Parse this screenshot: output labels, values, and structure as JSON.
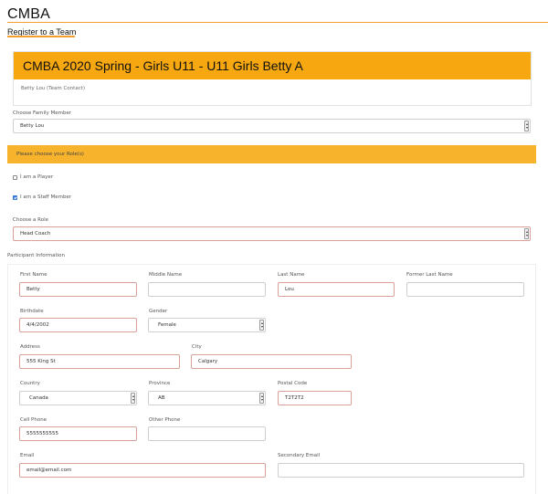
{
  "site": {
    "title": "CMBA",
    "breadcrumb": "Register to a Team"
  },
  "team": {
    "name": "CMBA 2020 Spring - Girls U11 - U11 Girls Betty A",
    "contact": "Betty Lou (Team Contact)"
  },
  "family": {
    "label": "Choose Family Member",
    "value": "Betty Lou"
  },
  "roles": {
    "banner": "Please choose your Role(s)",
    "player": {
      "label": "I am a Player",
      "checked": false
    },
    "staff": {
      "label": "I am a Staff Member",
      "checked": true
    },
    "role_label": "Choose a Role",
    "role_value": "Head Coach"
  },
  "participant": {
    "section_label": "Participant Information",
    "first_name": {
      "label": "First Name",
      "value": "Betty"
    },
    "middle_name": {
      "label": "Middle Name",
      "value": ""
    },
    "last_name": {
      "label": "Last Name",
      "value": "Lou"
    },
    "former_last_name": {
      "label": "Former Last Name",
      "value": ""
    },
    "birthdate": {
      "label": "Birthdate",
      "value": "4/4/2002"
    },
    "gender": {
      "label": "Gender",
      "value": "Female"
    },
    "address": {
      "label": "Address",
      "value": "555 King St"
    },
    "city": {
      "label": "City",
      "value": "Calgary"
    },
    "country": {
      "label": "Country",
      "value": "Canada"
    },
    "province": {
      "label": "Province",
      "value": "AB"
    },
    "postal_code": {
      "label": "Postal Code",
      "value": "T2T2T2"
    },
    "cell_phone": {
      "label": "Cell Phone",
      "value": "5555555555"
    },
    "other_phone": {
      "label": "Other Phone",
      "value": ""
    },
    "email": {
      "label": "Email",
      "value": "email@email.com"
    },
    "secondary_email": {
      "label": "Secondary Email",
      "value": ""
    }
  },
  "colors": {
    "accent": "#f7a70f",
    "banner": "#f7b32c",
    "error_border": "#d9a09a",
    "checkbox": "#3478d9"
  }
}
